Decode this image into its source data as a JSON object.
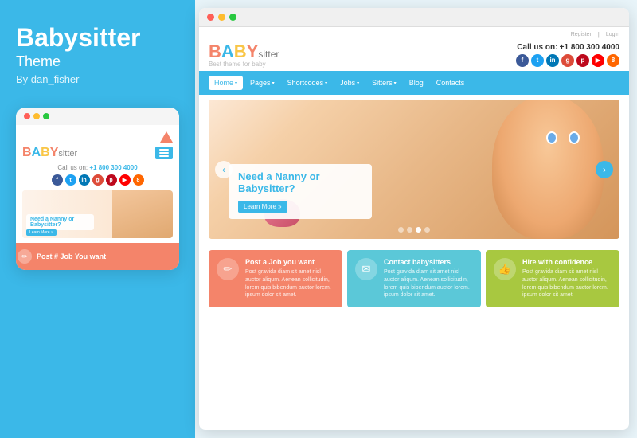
{
  "left": {
    "title": "Babysitter",
    "subtitle": "Theme",
    "author": "By dan_fisher",
    "mobile": {
      "call_label": "Call us on:",
      "call_number": "+1 800 300 4000",
      "hero_text": "Need a Nanny or Babysitter?",
      "hero_btn": "Learn More »",
      "bottom_card_text": "Post # Job You want"
    }
  },
  "browser": {
    "header": {
      "logo_text": "BABYsitter",
      "logo_tagline": "Best theme for baby",
      "call_label": "Call us on:",
      "call_number": "+1 800 300 4000",
      "register": "Register",
      "login": "Login"
    },
    "nav": [
      {
        "label": "Home",
        "active": true,
        "has_arrow": true
      },
      {
        "label": "Pages",
        "active": false,
        "has_arrow": true
      },
      {
        "label": "Shortcodes",
        "active": false,
        "has_arrow": true
      },
      {
        "label": "Jobs",
        "active": false,
        "has_arrow": true
      },
      {
        "label": "Sitters",
        "active": false,
        "has_arrow": true
      },
      {
        "label": "Blog",
        "active": false,
        "has_arrow": false
      },
      {
        "label": "Contacts",
        "active": false,
        "has_arrow": false
      }
    ],
    "hero": {
      "headline": "Need a Nanny or Babysitter?",
      "cta": "Learn More »"
    },
    "cards": [
      {
        "id": "post-job",
        "icon": "✏",
        "title": "Post a Job you want",
        "desc": "Post gravida diam sit amet nisl auctor aliqum. Aenean sollicitudin, lorem quis bibendum auctor lorem. ipsum dolor sit amet.",
        "color": "orange"
      },
      {
        "id": "contact-babysitters",
        "icon": "✉",
        "title": "Contact babysitters",
        "desc": "Post gravida diam sit amet nisl auctor aliqum. Aenean sollicitudin, lorem quis bibendum auctor lorem. ipsum dolor sit amet.",
        "color": "blue"
      },
      {
        "id": "hire-confidence",
        "icon": "👍",
        "title": "Hire with confidence",
        "desc": "Post gravida diam sit amet nisl auctor aliqum. Aenean sollicitudin, lorem quis bibendum auctor lorem. ipsum dolor sit amet.",
        "color": "green"
      }
    ],
    "social": [
      {
        "label": "f",
        "color": "#3b5998"
      },
      {
        "label": "t",
        "color": "#1da1f2"
      },
      {
        "label": "in",
        "color": "#0077b5"
      },
      {
        "label": "g+",
        "color": "#dd4b39"
      },
      {
        "label": "p",
        "color": "#bd081c"
      },
      {
        "label": "yt",
        "color": "#ff0000"
      },
      {
        "label": "8",
        "color": "#ff6600"
      }
    ]
  }
}
